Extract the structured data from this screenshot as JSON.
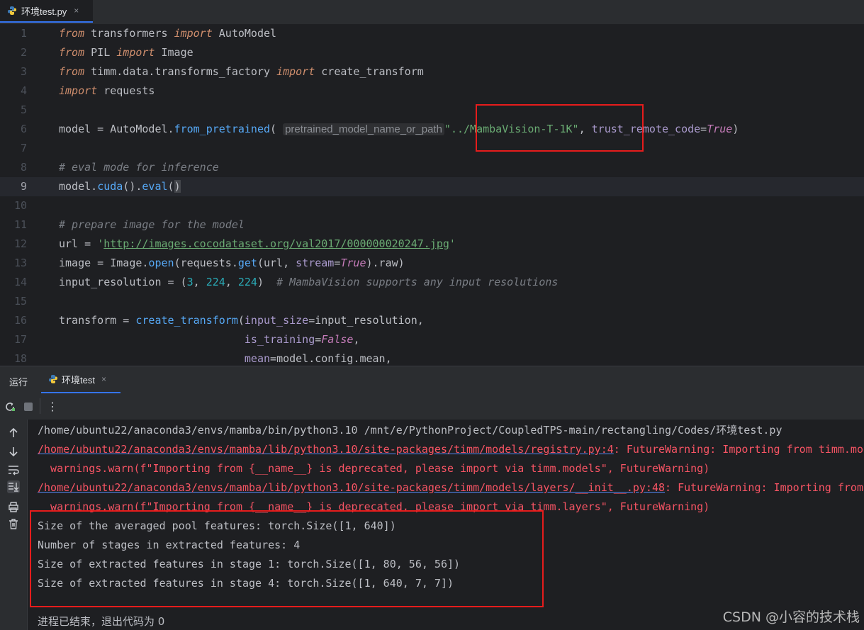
{
  "editor_tab": {
    "label": "环境test.py",
    "close": "×",
    "icon": "python-icon"
  },
  "line_numbers": [
    "1",
    "2",
    "3",
    "4",
    "5",
    "6",
    "7",
    "8",
    "9",
    "10",
    "11",
    "12",
    "13",
    "14",
    "15",
    "16",
    "17",
    "18"
  ],
  "code": {
    "l1": {
      "from": "from",
      "mod": " transformers ",
      "imp": "import",
      "rest": " AutoModel"
    },
    "l2": {
      "from": "from",
      "mod": " PIL ",
      "imp": "import",
      "rest": " Image"
    },
    "l3": {
      "from": "from",
      "mod": " timm.data.transforms_factory ",
      "imp": "import",
      "rest": " create_transform"
    },
    "l4": {
      "imp": "import",
      "rest": " requests"
    },
    "l6": {
      "a": "model = AutoModel.",
      "fn": "from_pretrained",
      "b": "(",
      "hint": "pretrained_model_name_or_path",
      "str": "\"../MambaVision-T-1K\"",
      "c": ", ",
      "kw": "trust_remote_code",
      "eq": "=",
      "val": "True",
      "d": ")"
    },
    "l8": {
      "comment": "# eval mode for inference"
    },
    "l9": {
      "a": "model.",
      "fn1": "cuda",
      "b": "().",
      "fn2": "eval",
      "c1": "(",
      "c2": ")"
    },
    "l11": {
      "comment": "# prepare image for the model"
    },
    "l12": {
      "a": "url = ",
      "q1": "'",
      "link": "http://images.cocodataset.org/val2017/000000020247.jpg",
      "q2": "'"
    },
    "l13": {
      "a": "image = Image.",
      "fn1": "open",
      "b": "(requests.",
      "fn2": "get",
      "c": "(url, ",
      "kw": "stream",
      "eq": "=",
      "val": "True",
      "d": ").raw)"
    },
    "l14": {
      "a": "input_resolution = (",
      "n1": "3",
      "s1": ", ",
      "n2": "224",
      "s2": ", ",
      "n3": "224",
      "b": ")  ",
      "comment": "# MambaVision supports any input resolutions"
    },
    "l16": {
      "a": "transform = ",
      "fn": "create_transform",
      "b": "(",
      "kw": "input_size",
      "eq": "=",
      "c": "input_resolution,"
    },
    "l17": {
      "pad": "                             ",
      "kw": "is_training",
      "eq": "=",
      "val": "False",
      "c": ","
    },
    "l18": {
      "pad": "                             ",
      "kw": "mean",
      "eq": "=",
      "c": "model.config.mean,"
    }
  },
  "run_panel": {
    "title": "运行",
    "tab_label": "环境test",
    "close": "×"
  },
  "toolbar": {
    "rerun": "rerun-icon",
    "stop": "stop-icon",
    "more": "⋮"
  },
  "sidebar_icons": [
    "up-arrow-icon",
    "down-arrow-icon",
    "soft-wrap-icon",
    "scroll-to-end-icon",
    "print-icon",
    "trash-icon"
  ],
  "console": {
    "l1": "/home/ubuntu22/anaconda3/envs/mamba/bin/python3.10 /mnt/e/PythonProject/CoupledTPS-main/rectangling/Codes/环境test.py",
    "l2_link": "/home/ubuntu22/anaconda3/envs/mamba/lib/python3.10/site-packages/timm/models/registry.py:4",
    "l2_rest": ": FutureWarning: Importing from timm.models.registry is deprecated, please import via timm.models",
    "l3": "  warnings.warn(f\"Importing from {__name__} is deprecated, please import via timm.models\", FutureWarning)",
    "l4_link": "/home/ubuntu22/anaconda3/envs/mamba/lib/python3.10/site-packages/timm/models/layers/__init__.py:48",
    "l4_rest": ": FutureWarning: Importing from timm.models.layers is deprecated",
    "l5": "  warnings.warn(f\"Importing from {__name__} is deprecated, please import via timm.layers\", FutureWarning)",
    "l6": "Size of the averaged pool features: torch.Size([1, 640])",
    "l7": "Number of stages in extracted features: 4",
    "l8": "Size of extracted features in stage 1: torch.Size([1, 80, 56, 56])",
    "l9": "Size of extracted features in stage 4: torch.Size([1, 640, 7, 7])",
    "l10": "进程已结束，退出代码为 0"
  },
  "watermark": "CSDN @小容的技术栈",
  "colors": {
    "background": "#1e1f22",
    "panel": "#2b2d30",
    "keyword": "#cf8e6d",
    "function": "#56a8f5",
    "string": "#6aab73",
    "error": "#f75464",
    "highlight_box": "#e61c1c"
  }
}
